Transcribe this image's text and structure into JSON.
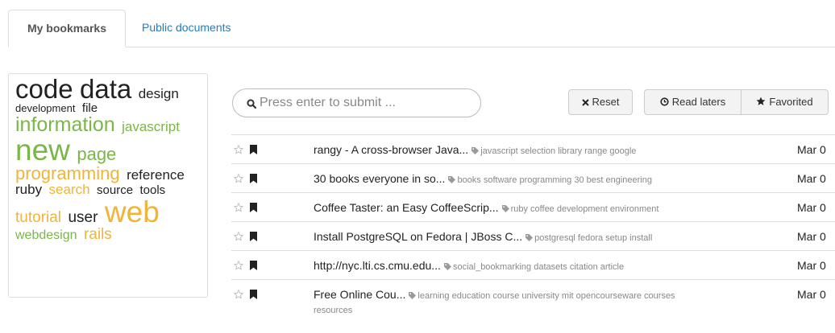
{
  "tabs": [
    {
      "label": "My bookmarks",
      "active": true
    },
    {
      "label": "Public documents",
      "active": false
    }
  ],
  "tag_cloud": [
    {
      "text": "code",
      "size": 33,
      "color": "black"
    },
    {
      "text": "data",
      "size": 33,
      "color": "black"
    },
    {
      "text": "design",
      "size": 17,
      "color": "black"
    },
    {
      "text": "development",
      "size": 13,
      "color": "black"
    },
    {
      "text": "file",
      "size": 15,
      "color": "black"
    },
    {
      "text": "information",
      "size": 25,
      "color": "green"
    },
    {
      "text": "javascript",
      "size": 17,
      "color": "green"
    },
    {
      "text": "new",
      "size": 37,
      "color": "green"
    },
    {
      "text": "page",
      "size": 22,
      "color": "green"
    },
    {
      "text": "programming",
      "size": 22,
      "color": "yellow"
    },
    {
      "text": "reference",
      "size": 17,
      "color": "black"
    },
    {
      "text": "ruby",
      "size": 17,
      "color": "black"
    },
    {
      "text": "search",
      "size": 17,
      "color": "yellow"
    },
    {
      "text": "source",
      "size": 15,
      "color": "black"
    },
    {
      "text": "tools",
      "size": 15,
      "color": "black"
    },
    {
      "text": "tutorial",
      "size": 19,
      "color": "yellow"
    },
    {
      "text": "user",
      "size": 19,
      "color": "black"
    },
    {
      "text": "web",
      "size": 37,
      "color": "yellow"
    },
    {
      "text": "webdesign",
      "size": 16,
      "color": "green"
    },
    {
      "text": "rails",
      "size": 19,
      "color": "yellow"
    }
  ],
  "search": {
    "placeholder": "Press enter to submit ...",
    "icon": "search-icon"
  },
  "buttons": {
    "reset": "Reset",
    "read_laters": "Read laters",
    "favorited": "Favorited"
  },
  "bookmarks": [
    {
      "title": "rangy - A cross-browser Java...",
      "tags": "javascript selection library range google",
      "date": "Mar 0"
    },
    {
      "title": "30 books everyone in so...",
      "tags": "books software programming 30 best engineering",
      "date": "Mar 0"
    },
    {
      "title": "Coffee Taster: an Easy CoffeeScrip...",
      "tags": "ruby coffee development environment",
      "date": "Mar 0"
    },
    {
      "title": "Install PostgreSQL on Fedora | JBoss C...",
      "tags": "postgresql fedora setup install",
      "date": "Mar 0"
    },
    {
      "title": "http://nyc.lti.cs.cmu.edu...",
      "tags": "social_bookmarking datasets citation article",
      "date": "Mar 0"
    },
    {
      "title": "Free Online Cou...",
      "tags": "learning education course university mit opencourseware courses",
      "tags_continued": "resources",
      "date": "Mar 0"
    }
  ],
  "colors": {
    "green": "#7ab648",
    "yellow": "#f0b43a",
    "link": "#2a7ab8",
    "border": "#dddddd"
  }
}
